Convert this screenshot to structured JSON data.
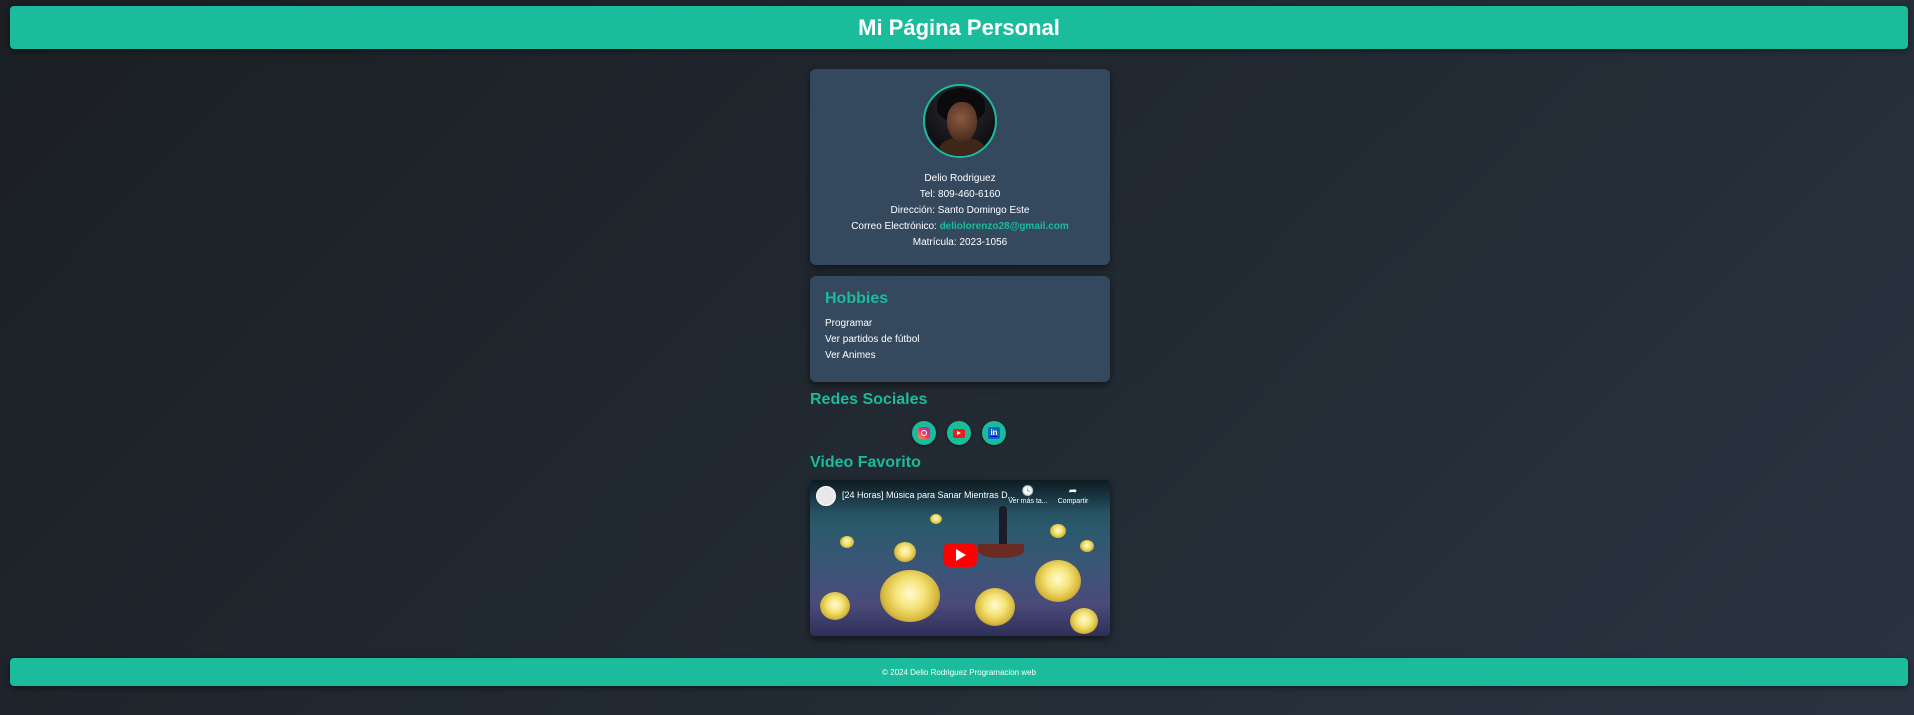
{
  "header": {
    "title": "Mi Página Personal"
  },
  "profile": {
    "name": "Delio Rodriguez",
    "phone": "Tel: 809-460-6160",
    "address": "Dirección: Santo Domingo Este",
    "email_label": "Correo Electrónico: ",
    "email": "deliolorenzo28@gmail.com",
    "id": "Matrícula: 2023-1056"
  },
  "hobbies": {
    "title": "Hobbies",
    "items": [
      "Programar",
      "Ver partidos de fútbol",
      "Ver Animes"
    ]
  },
  "social": {
    "title": "Redes Sociales",
    "icons": [
      "instagram-icon",
      "youtube-icon",
      "linkedin-icon"
    ],
    "linkedin_glyph": "in"
  },
  "video": {
    "title": "Video Favorito",
    "embed_title": "[24 Horas] Música para Sanar Mientras D...",
    "watch_later": "Ver más ta...",
    "share": "Compartir"
  },
  "footer": {
    "text": "© 2024 Delio Rodriguez Programacion web"
  },
  "colors": {
    "accent": "#1abc9c",
    "card": "#34495e",
    "youtube_red": "#ff0000"
  }
}
